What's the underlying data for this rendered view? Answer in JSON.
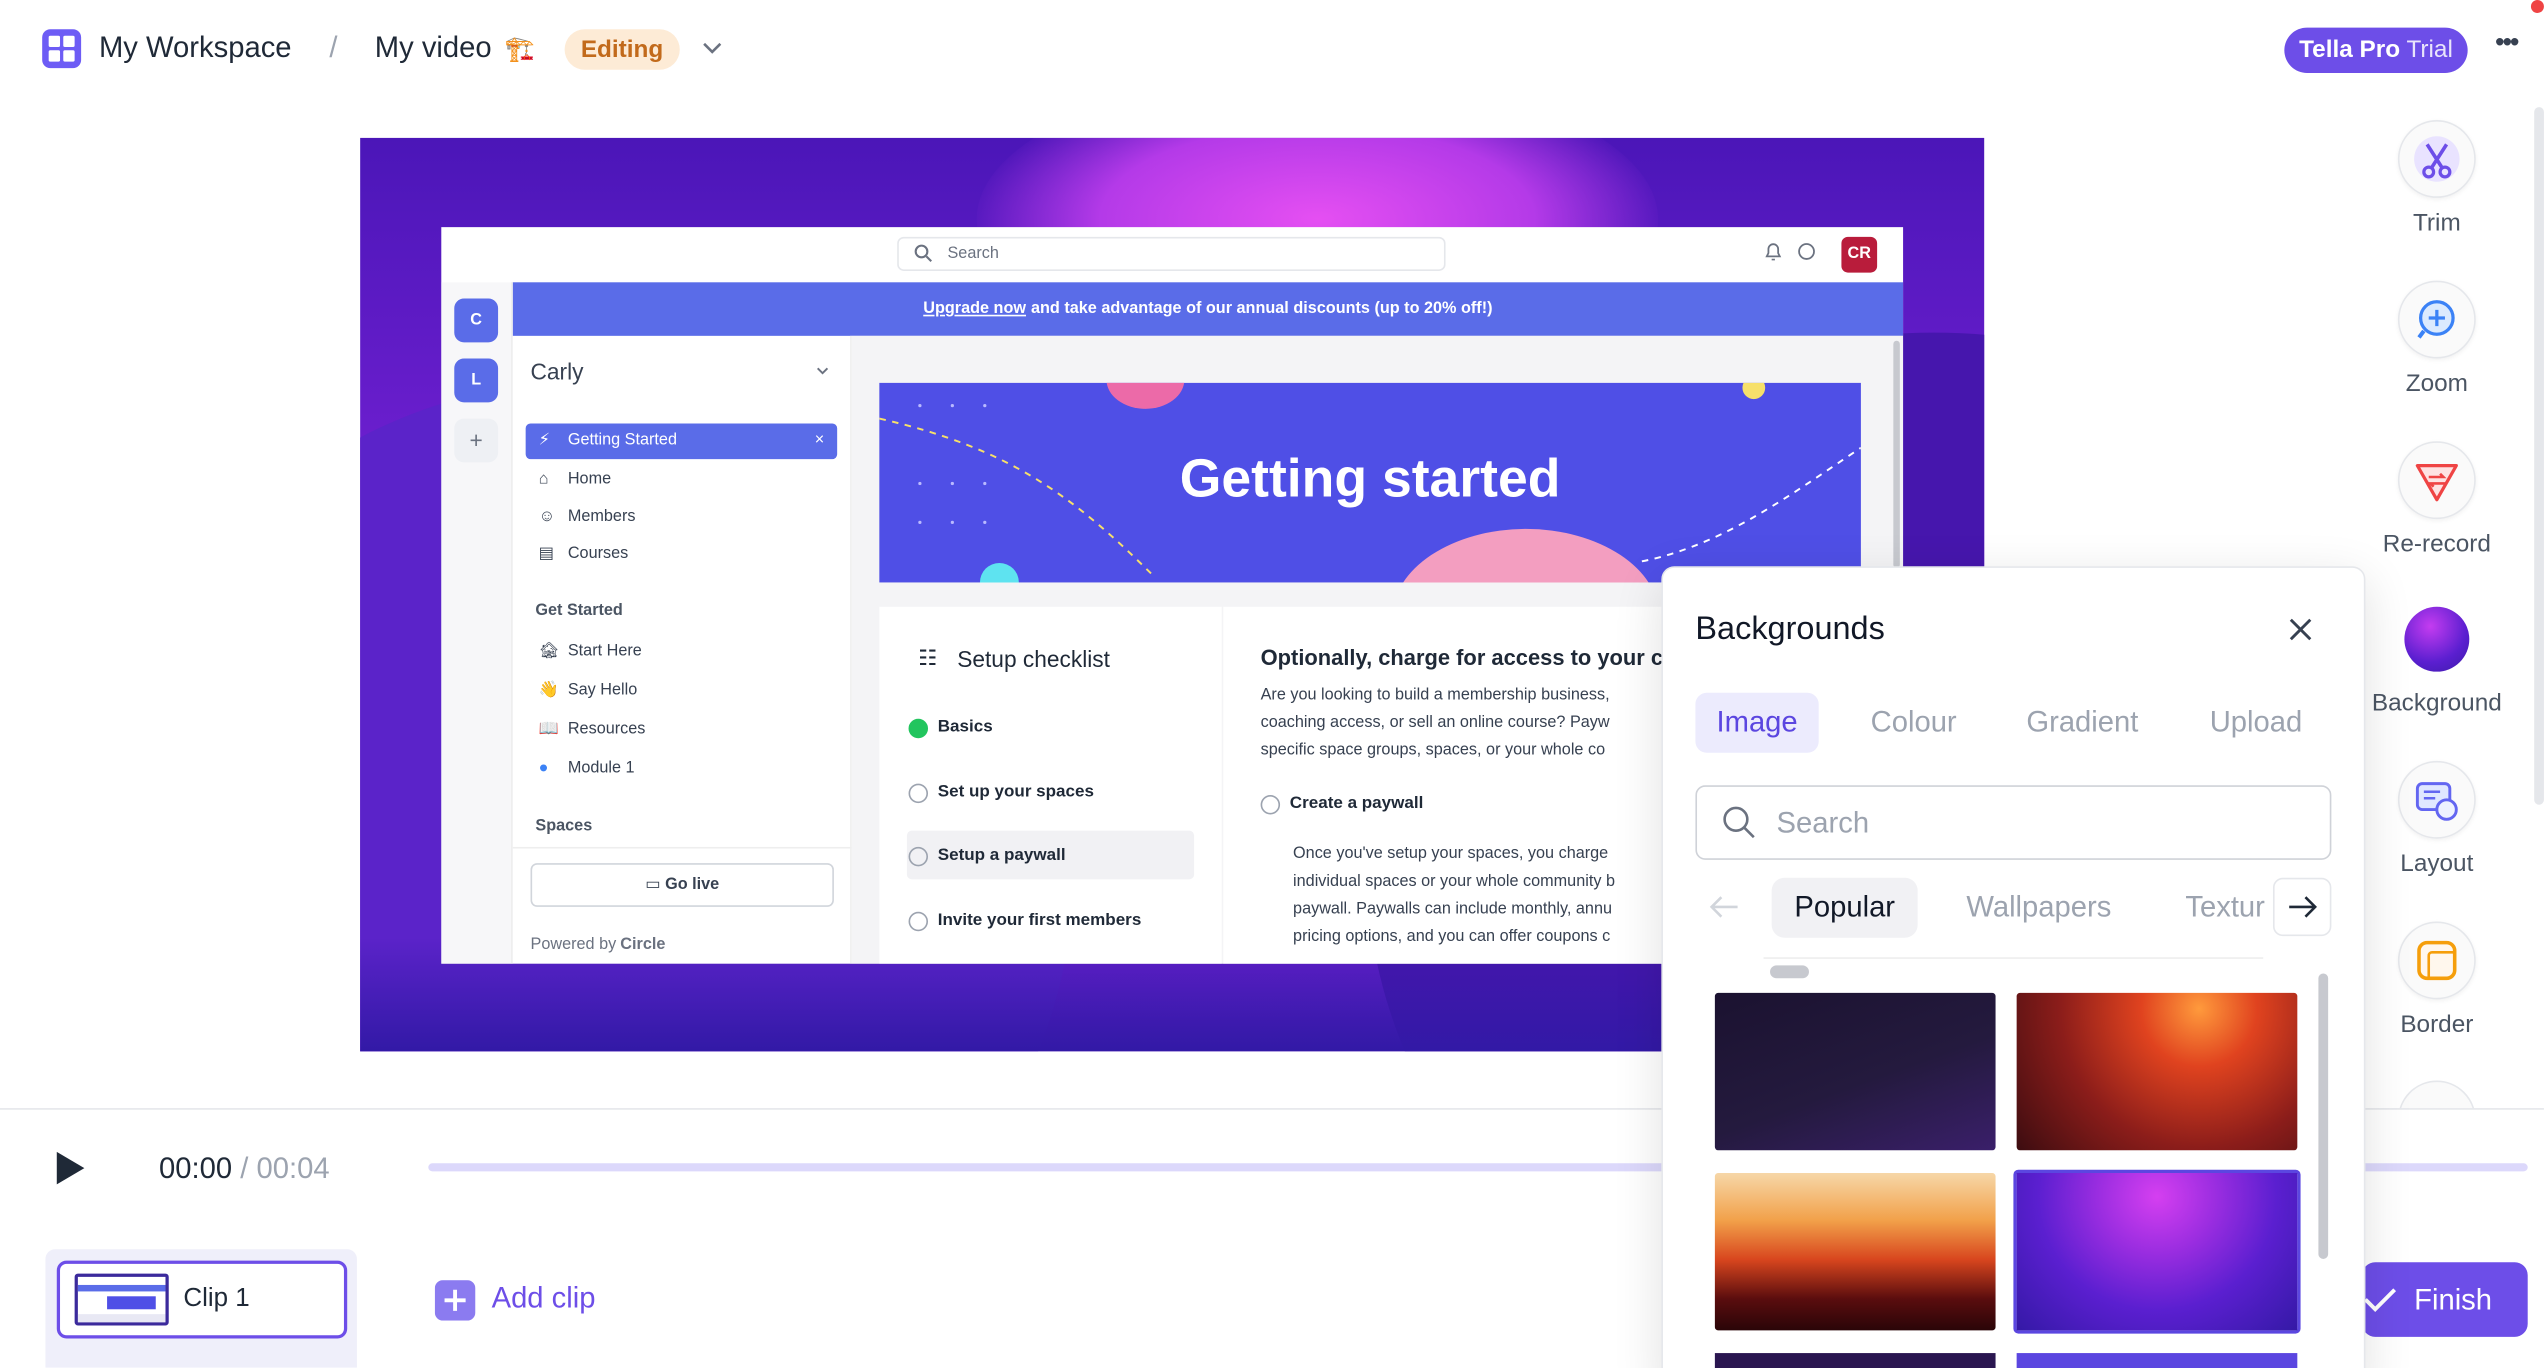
{
  "topbar": {
    "workspace": "My Workspace",
    "separator": "/",
    "video_title": "My video",
    "video_emoji": "🏗️",
    "status": "Editing",
    "pro_label_bold": "Tella Pro",
    "pro_label_rest": "Trial",
    "more": "•••"
  },
  "preview": {
    "search_placeholder": "Search",
    "avatar": "CR",
    "banner_link": "Upgrade now",
    "banner_text": "and take advantage of our annual discounts (up to 20% off!)",
    "rail": [
      "C",
      "L",
      "+"
    ],
    "community": "Carly",
    "nav": [
      {
        "label": "Getting Started",
        "icon": "⚡"
      },
      {
        "label": "Home",
        "icon": "⌂"
      },
      {
        "label": "Members",
        "icon": "☺"
      },
      {
        "label": "Courses",
        "icon": "▤"
      }
    ],
    "section_get_started": "Get Started",
    "get_started": [
      {
        "label": "Start Here",
        "icon": "🏚"
      },
      {
        "label": "Say Hello",
        "icon": "👋"
      },
      {
        "label": "Resources",
        "icon": "📖"
      },
      {
        "label": "Module 1",
        "icon": "●"
      }
    ],
    "section_spaces": "Spaces",
    "go_live": "Go live",
    "powered": "Powered by",
    "powered_brand": "Circle",
    "hero_title": "Getting started",
    "checklist_title": "Setup checklist",
    "checklist": [
      "Basics",
      "Set up your spaces",
      "Setup a paywall",
      "Invite your first members"
    ],
    "detail_title": "Optionally, charge for access to your c",
    "detail_lines": [
      "Are you looking to build a membership business,",
      "coaching access, or sell an online course? Payw",
      "specific space groups, spaces, or your whole co"
    ],
    "paywall_item": "Create a paywall",
    "paywall_lines": [
      "Once you've setup your spaces, you charge",
      "individual spaces or your whole community b",
      "paywall. Paywalls can include monthly, annu",
      "pricing options, and you can offer coupons c"
    ]
  },
  "tools": [
    {
      "label": "Trim",
      "icon": "scissors-icon"
    },
    {
      "label": "Zoom",
      "icon": "zoom-icon"
    },
    {
      "label": "Re-record",
      "icon": "rerecord-icon"
    },
    {
      "label": "Background",
      "icon": "background-icon"
    },
    {
      "label": "Layout",
      "icon": "layout-icon"
    },
    {
      "label": "Border",
      "icon": "border-icon"
    }
  ],
  "player": {
    "current": "00:00",
    "divider": "/",
    "total": "00:04",
    "progress": 0
  },
  "clips": [
    {
      "label": "Clip 1"
    }
  ],
  "add_clip": "Add clip",
  "finish": "Finish",
  "backgrounds": {
    "title": "Backgrounds",
    "tabs": [
      "Image",
      "Colour",
      "Gradient",
      "Upload"
    ],
    "active_tab": "Image",
    "search_placeholder": "Search",
    "categories": [
      "Popular",
      "Wallpapers",
      "Textur"
    ],
    "active_category": "Popular"
  },
  "colors": {
    "accent": "#6d4ee8",
    "banner": "#5a6ce8"
  }
}
